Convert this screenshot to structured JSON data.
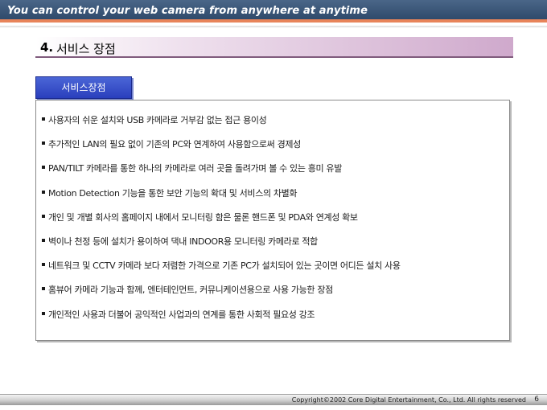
{
  "banner": {
    "tagline": "You can control your web camera  from anywhere at anytime"
  },
  "section": {
    "number": "4.",
    "title": "서비스 장점"
  },
  "tab": {
    "label": "서비스장점"
  },
  "items": [
    "사용자의 쉬운 설치와 USB 카메라로 거부감 없는 접근 용이성",
    "추가적인 LAN의 필요 없이 기존의 PC와 연계하여 사용함으로써 경제성",
    "PAN/TILT 카메라를 통한 하나의 카메라로 여러 곳을 돌려가며 볼 수 있는 흥미 유발",
    "Motion Detection 기능을 통한 보안 기능의 확대 및 서비스의 차별화",
    "개인 및 개별 회사의 홈페이지 내에서 모니터링 함은 물론 핸드폰 및 PDA와 연계성 확보",
    "벽이나 천정 등에 설치가 용이하여 댁내 INDOOR용 모니터링 카메라로 적합",
    "네트워크 및 CCTV 카메라 보다 저렴한 가격으로 기존 PC가 설치되어 있는 곳이면 어디든 설치 사용",
    "홈뷰어 카메라 기능과 함께, 엔터테인먼트, 커뮤니케이션용으로 사용 가능한 장점",
    "개인적인 사용과 더불어 공익적인 사업과의 연계를 통한 사회적 필요성 강조"
  ],
  "footer": {
    "copyright": "Copyright©2002 Core Digital Entertainment, Co., Ltd. All rights reserved",
    "page_number": "6"
  },
  "colors": {
    "banner": "#2f4a6b",
    "banner_accent": "#e8845a",
    "header_purple": "#cfa9cc",
    "tab_blue": "#2a3fbd"
  }
}
